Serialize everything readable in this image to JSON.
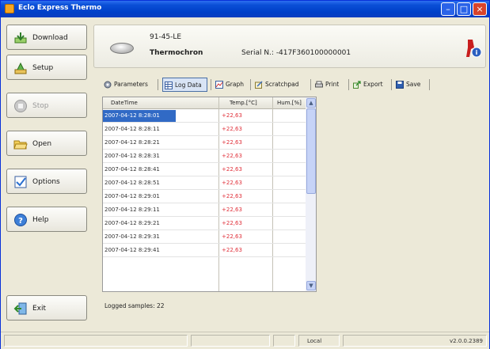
{
  "window": {
    "title": "Eclo Express Thermo"
  },
  "sidebar": {
    "items": [
      {
        "label": "Download",
        "icon": "download-icon"
      },
      {
        "label": "Setup",
        "icon": "setup-icon"
      },
      {
        "label": "Stop",
        "icon": "stop-icon"
      },
      {
        "label": "Open",
        "icon": "folder-open-icon"
      },
      {
        "label": "Options",
        "icon": "options-icon"
      },
      {
        "label": "Help",
        "icon": "help-icon"
      }
    ],
    "exit_label": "Exit"
  },
  "device": {
    "id": "91-45-LE",
    "name": "Thermochron",
    "serial": "Serial N.: -417F360100000001"
  },
  "toolbar": {
    "parameters": "Parameters",
    "log_data": "Log Data",
    "graph": "Graph",
    "scratchpad": "Scratchpad",
    "print": "Print",
    "export": "Export",
    "save": "Save"
  },
  "grid": {
    "headers": [
      "DateTime",
      "Temp.[°C]",
      "Hum.[%]"
    ],
    "rows": [
      {
        "datetime": "2007-04-12 8:28:01",
        "temp": "+22,63"
      },
      {
        "datetime": "2007-04-12 8:28:11",
        "temp": "+22,63"
      },
      {
        "datetime": "2007-04-12 8:28:21",
        "temp": "+22,63"
      },
      {
        "datetime": "2007-04-12 8:28:31",
        "temp": "+22,63"
      },
      {
        "datetime": "2007-04-12 8:28:41",
        "temp": "+22,63"
      },
      {
        "datetime": "2007-04-12 8:28:51",
        "temp": "+22,63"
      },
      {
        "datetime": "2007-04-12 8:29:01",
        "temp": "+22,63"
      },
      {
        "datetime": "2007-04-12 8:29:11",
        "temp": "+22,63"
      },
      {
        "datetime": "2007-04-12 8:29:21",
        "temp": "+22,63"
      },
      {
        "datetime": "2007-04-12 8:29:31",
        "temp": "+22,63"
      },
      {
        "datetime": "2007-04-12 8:29:41",
        "temp": "+22,63"
      }
    ]
  },
  "footer": {
    "logged_samples": "Logged samples: 22"
  },
  "statusbar": {
    "mode": "Local",
    "version": "v2.0.0.2389"
  },
  "colors": {
    "accent": "#0a4fd7",
    "selection": "#316ac5",
    "temperature_text": "#e0303a"
  }
}
